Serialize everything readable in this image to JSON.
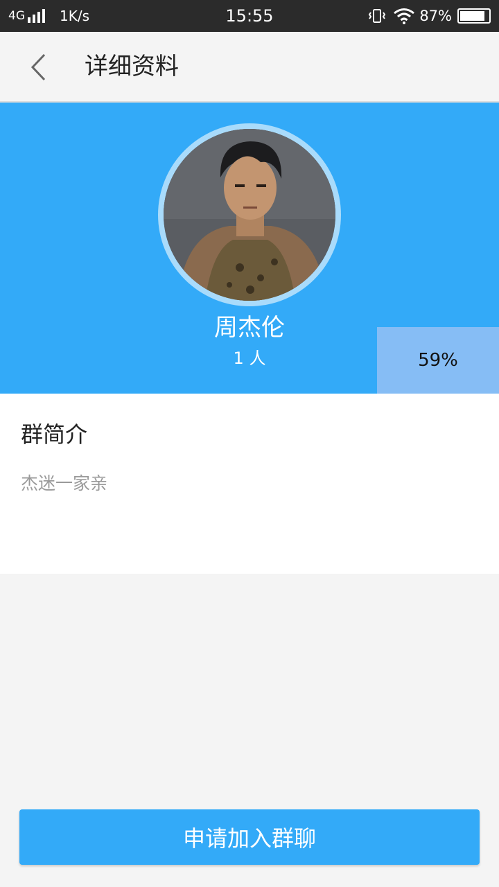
{
  "status_bar": {
    "network": "4G",
    "speed": "1K/s",
    "time": "15:55",
    "battery": "87%",
    "battery_level": 0.87,
    "icons": [
      "signal-icon",
      "vibrate-icon",
      "wifi-icon",
      "battery-icon"
    ]
  },
  "header": {
    "title": "详细资料",
    "back_icon": "back-chevron-icon"
  },
  "group": {
    "name": "周杰伦",
    "members": "1 人",
    "progress": "59%"
  },
  "intro": {
    "heading": "群简介",
    "text": "杰迷一家亲"
  },
  "actions": {
    "join_label": "申请加入群聊"
  },
  "colors": {
    "accent": "#33aaf8",
    "status_bar": "#2b2b2b",
    "background": "#f4f4f4",
    "progress_box": "#86bdf5"
  }
}
